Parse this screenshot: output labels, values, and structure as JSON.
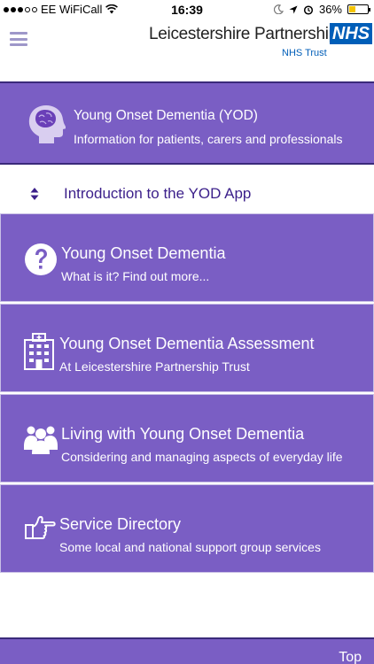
{
  "status_bar": {
    "carrier": "EE WiFiCall",
    "time": "16:39",
    "battery": "36%",
    "battery_level": 0.36
  },
  "header": {
    "org_name": "Leicestershire Partnership",
    "nhs_logo": "NHS",
    "trust_name": "NHS Trust"
  },
  "banner": {
    "title": "Young Onset Dementia (YOD)",
    "subtitle": "Information for patients, carers and professionals"
  },
  "intro": {
    "label": "Introduction to the YOD App"
  },
  "cards": [
    {
      "title": "Young Onset Dementia",
      "subtitle": "What is it? Find out more...",
      "icon": "question-circle-icon"
    },
    {
      "title": "Young Onset Dementia Assessment",
      "subtitle": "At Leicestershire Partnership Trust",
      "icon": "hospital-building-icon"
    },
    {
      "title": "Living with Young Onset Dementia",
      "subtitle": "Considering and managing aspects of everyday life",
      "icon": "people-group-icon"
    },
    {
      "title": "Service Directory",
      "subtitle": "Some local and national support group services",
      "icon": "pointing-hand-icon"
    }
  ],
  "footer": {
    "top_label": "Top"
  },
  "colors": {
    "primary_purple": "#7a5ec4",
    "dark_border": "#3a2a7a",
    "nhs_blue": "#005eb8",
    "intro_text": "#3b1f8a"
  }
}
